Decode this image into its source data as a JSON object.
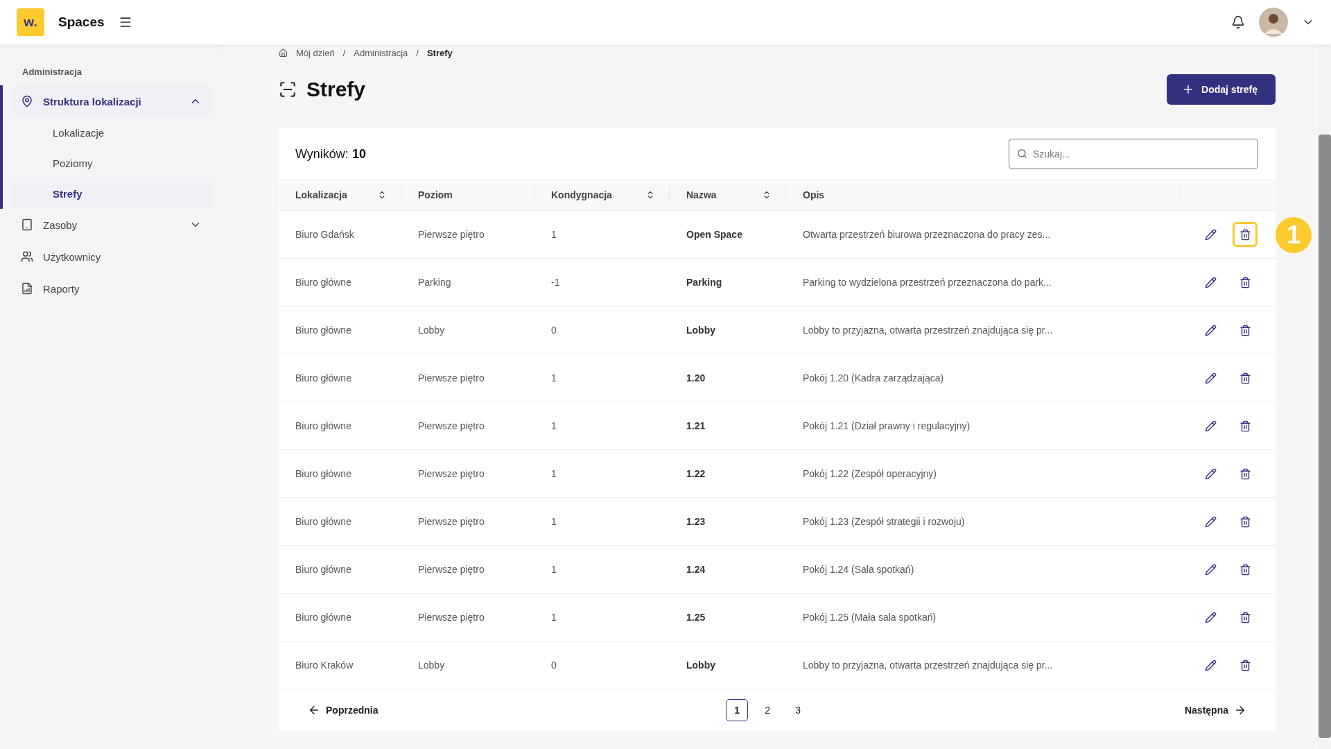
{
  "header": {
    "logo": "w.",
    "app_name": "Spaces"
  },
  "breadcrumb": {
    "separator": "/",
    "items": [
      "Mój dzień",
      "Administracja",
      "Strefy"
    ]
  },
  "sidebar": {
    "section": "Administracja",
    "items": [
      {
        "label": "Struktura lokalizacji",
        "selected": true,
        "expanded": true,
        "children": [
          {
            "label": "Lokalizacje",
            "selected": false
          },
          {
            "label": "Poziomy",
            "selected": false
          },
          {
            "label": "Strefy",
            "selected": true
          }
        ]
      },
      {
        "label": "Zasoby",
        "selected": false,
        "expanded": false
      },
      {
        "label": "Użytkownicy",
        "selected": false
      },
      {
        "label": "Raporty",
        "selected": false
      }
    ]
  },
  "page": {
    "title": "Strefy",
    "add_button": "Dodaj strefę"
  },
  "table": {
    "results_label": "Wyników:",
    "results_count": "10",
    "search": {
      "placeholder": "Szukaj..."
    },
    "columns": [
      {
        "label": "Lokalizacja",
        "sortable": true
      },
      {
        "label": "Poziom",
        "sortable": false
      },
      {
        "label": "Kondygnacja",
        "sortable": true
      },
      {
        "label": "Nazwa",
        "sortable": true
      },
      {
        "label": "Opis",
        "sortable": false
      }
    ],
    "rows": [
      {
        "cells": [
          "Biuro Gdańsk",
          "Pierwsze piętro",
          "1",
          "Open Space",
          "Otwarta przestrzeń biurowa przeznaczona do pracy zes..."
        ],
        "highlighted": true,
        "callout": "1"
      },
      {
        "cells": [
          "Biuro główne",
          "Parking",
          "-1",
          "Parking",
          "Parking to wydzielona przestrzeń przeznaczona do park..."
        ],
        "highlighted": false
      },
      {
        "cells": [
          "Biuro główne",
          "Lobby",
          "0",
          "Lobby",
          "Lobby to przyjazna, otwarta przestrzeń znajdująca się pr..."
        ],
        "highlighted": false
      },
      {
        "cells": [
          "Biuro główne",
          "Pierwsze piętro",
          "1",
          "1.20",
          "Pokój 1.20 (Kadra zarządzająca)"
        ],
        "highlighted": false
      },
      {
        "cells": [
          "Biuro główne",
          "Pierwsze piętro",
          "1",
          "1.21",
          "Pokój 1.21 (Dział prawny i regulacyjny)"
        ],
        "highlighted": false
      },
      {
        "cells": [
          "Biuro główne",
          "Pierwsze piętro",
          "1",
          "1.22",
          "Pokój 1.22 (Zespół operacyjny)"
        ],
        "highlighted": false
      },
      {
        "cells": [
          "Biuro główne",
          "Pierwsze piętro",
          "1",
          "1.23",
          "Pokój 1.23 (Zespół strategii i rozwoju)"
        ],
        "highlighted": false
      },
      {
        "cells": [
          "Biuro główne",
          "Pierwsze piętro",
          "1",
          "1.24",
          "Pokój 1.24 (Sala spotkań)"
        ],
        "highlighted": false
      },
      {
        "cells": [
          "Biuro główne",
          "Pierwsze piętro",
          "1",
          "1.25",
          "Pokój 1.25 (Mała sala spotkań)"
        ],
        "highlighted": false
      },
      {
        "cells": [
          "Biuro Kraków",
          "Lobby",
          "0",
          "Lobby",
          "Lobby to przyjazna, otwarta przestrzeń znajdująca się pr..."
        ],
        "highlighted": false
      }
    ]
  },
  "pagination": {
    "previous": "Poprzednia",
    "next": "Następna",
    "pages": [
      {
        "label": "1",
        "selected": true
      },
      {
        "label": "2",
        "selected": false
      },
      {
        "label": "3",
        "selected": false
      }
    ]
  }
}
